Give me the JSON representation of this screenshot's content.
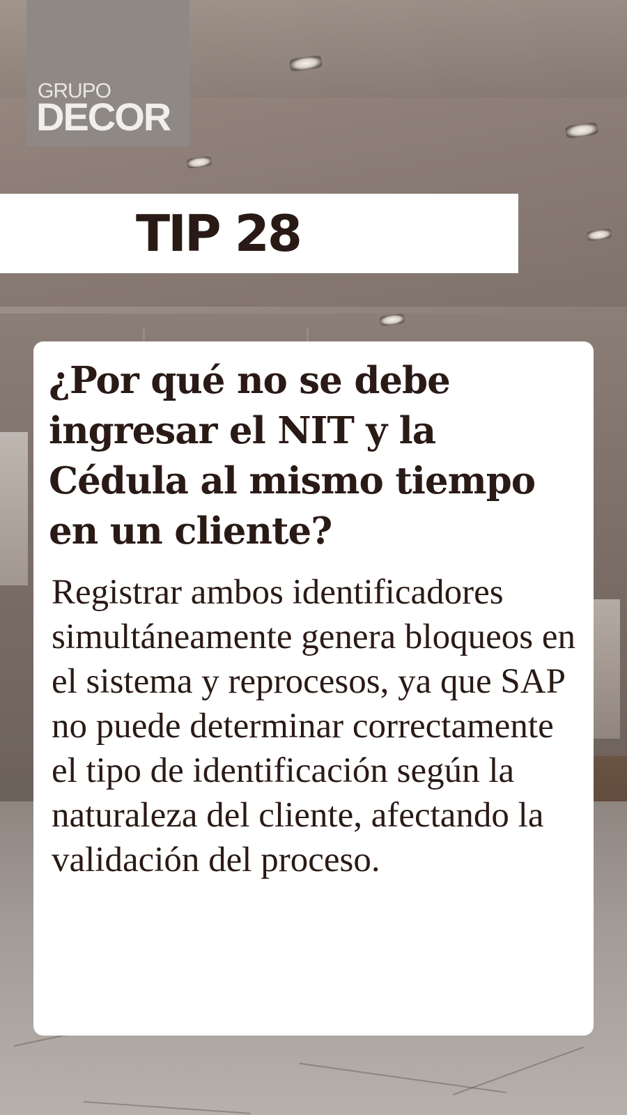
{
  "brand": {
    "top": "GRUPO",
    "bottom": "DECOR"
  },
  "tip": {
    "title": "TIP 28"
  },
  "card": {
    "question": "¿Por qué no se debe ingresar el NIT y la Cédula al mismo tiempo en un cliente?",
    "answer": "Registrar ambos identificadores simultáneamente genera bloqueos en el sistema y reprocesos, ya que SAP no puede determinar correctamente el tipo de identificación según la naturaleza del cliente, afectando la validación del proceso."
  },
  "colors": {
    "text": "#2a1a16",
    "card": "#ffffff",
    "logo_bg": "#8e8985"
  }
}
